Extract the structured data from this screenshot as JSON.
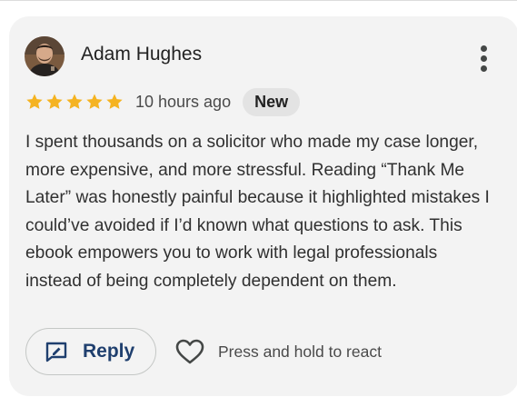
{
  "review": {
    "author_name": "Adam Hughes",
    "avatar_icon": "user-avatar-photo",
    "more_icon": "more-vertical-icon",
    "rating": 5,
    "rating_max": 5,
    "star_color": "#F5B321",
    "time_ago": "10 hours ago",
    "badge": "New",
    "text": "I spent thousands on a solicitor who made my case longer, more expensive, and more stressful. Reading “Thank Me Later” was honestly painful because it highlighted mistakes I could’ve avoided if I’d known what questions to ask. This ebook empowers you to work with legal professionals instead of being completely dependent on them."
  },
  "actions": {
    "reply_label": "Reply",
    "reply_icon": "reply-edit-icon",
    "react_icon": "heart-outline-icon",
    "react_hint": "Press and hold to react"
  },
  "colors": {
    "card_background": "#F3F3F3",
    "reply_accent": "#1F3F6E",
    "badge_background": "#E3E3E3"
  }
}
